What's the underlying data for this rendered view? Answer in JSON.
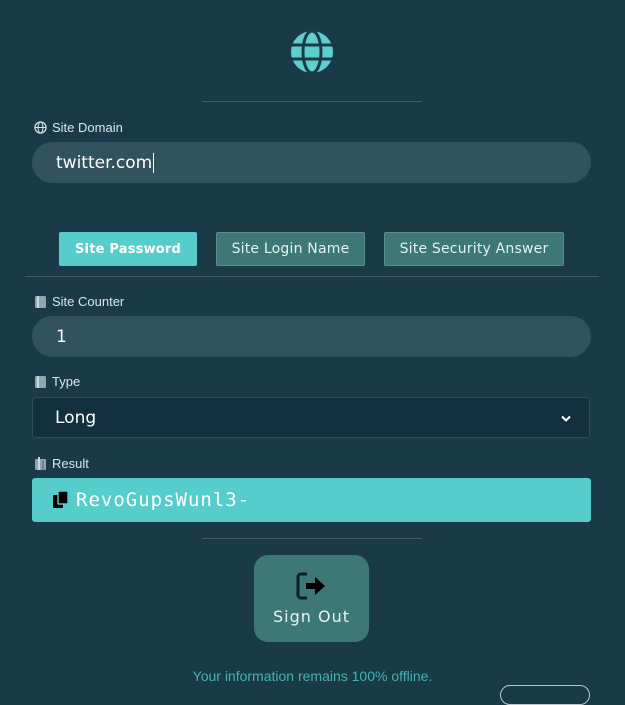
{
  "app": {
    "logo_icon": "globe-icon"
  },
  "site_domain": {
    "label": "Site Domain",
    "icon": "globe-small-icon",
    "value": "twitter.com"
  },
  "tabs": [
    {
      "label": "Site Password",
      "active": true
    },
    {
      "label": "Site Login Name",
      "active": false
    },
    {
      "label": "Site Security Answer",
      "active": false
    }
  ],
  "site_counter": {
    "label": "Site Counter",
    "icon": "counter-icon",
    "value": "1"
  },
  "type": {
    "label": "Type",
    "icon": "type-icon",
    "selected": "Long"
  },
  "result": {
    "label": "Result",
    "icon": "result-icon",
    "value": "RevoGupsWunl3-",
    "copy_icon": "copy-icon"
  },
  "signout": {
    "label": "Sign Out",
    "icon": "sign-out-icon"
  },
  "footer": {
    "text": "Your information remains 100% offline."
  },
  "colors": {
    "background": "#1b3a48",
    "accent": "#57cdcb",
    "muted_teal": "#3d7777",
    "input_bg": "#33525f",
    "footer_text": "#42b5b3"
  }
}
